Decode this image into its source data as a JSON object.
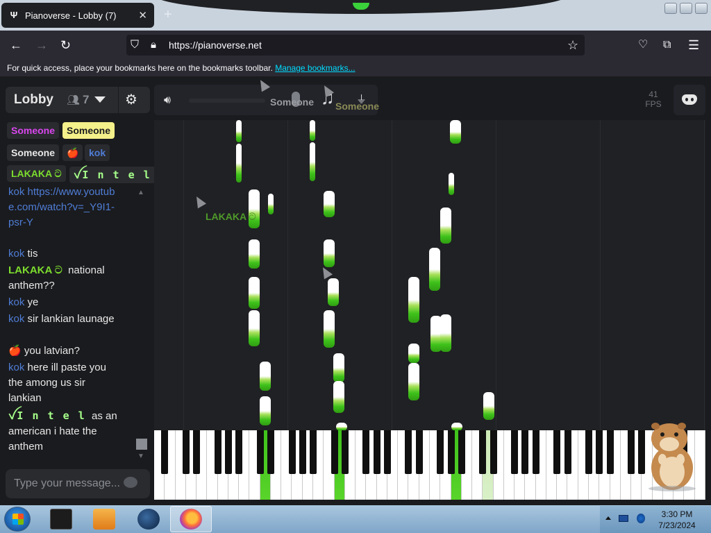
{
  "browser": {
    "tab_title": "Pianoverse - Lobby (7)",
    "tab_close": "✕",
    "new_tab": "+",
    "url": "https://pianoverse.net",
    "bookmarks_text": "For quick access, place your bookmarks here on the bookmarks toolbar.",
    "bookmarks_link": "Manage bookmarks..."
  },
  "room": {
    "name": "Lobby",
    "user_count": "7",
    "users": [
      "Someone",
      "Someone",
      "Someone",
      "🍎",
      "kok",
      "LAKAKA ට",
      "ꪜI n t e l"
    ]
  },
  "chat": {
    "messages": [
      {
        "name": "kok",
        "text": "https://www.youtube.com/watch?v=_Y9I1-psr-Y"
      },
      {
        "name": "kok",
        "text": "tis"
      },
      {
        "name": "LAKAKA ට",
        "text": "national anthem??"
      },
      {
        "name": "kok",
        "text": "ye"
      },
      {
        "name": "kok",
        "text": "sir lankian launage"
      },
      {
        "name": "🍎",
        "text": "you latvian?"
      },
      {
        "name": "kok",
        "text": "here ill paste you the among us sir lankian"
      },
      {
        "name": "ꪜI n t e l",
        "text": "as an american i hate the anthem"
      }
    ],
    "input_placeholder": "Type your message..."
  },
  "controls": {
    "fps_value": "41",
    "fps_label": "FPS"
  },
  "cursors": [
    {
      "label": "Someone",
      "color": "#9a9ca1"
    },
    {
      "label": "Someone",
      "color": "#8a8a55"
    },
    {
      "label": "LAKAKA ට",
      "color": "#4f9a2a"
    }
  ],
  "taskbar": {
    "time": "3:30 PM",
    "date": "7/23/2024"
  },
  "colors": {
    "accent_green": "#3fc21b",
    "kok": "#4f7dd6",
    "lakaka": "#7cdd2e",
    "someone_magenta": "#d946ef",
    "someone_yellow": "#f4f08a"
  },
  "icons": [
    "pianoverse-logo-icon",
    "back-icon",
    "forward-icon",
    "reload-icon",
    "shield-icon",
    "lock-icon",
    "star-icon",
    "pocket-icon",
    "extensions-icon",
    "menu-icon",
    "users-icon",
    "chevron-down-icon",
    "gear-icon",
    "volume-icon",
    "mic-icon",
    "music-note-icon",
    "plug-icon",
    "discord-icon",
    "send-icon",
    "windows-start-icon",
    "firefox-icon"
  ]
}
